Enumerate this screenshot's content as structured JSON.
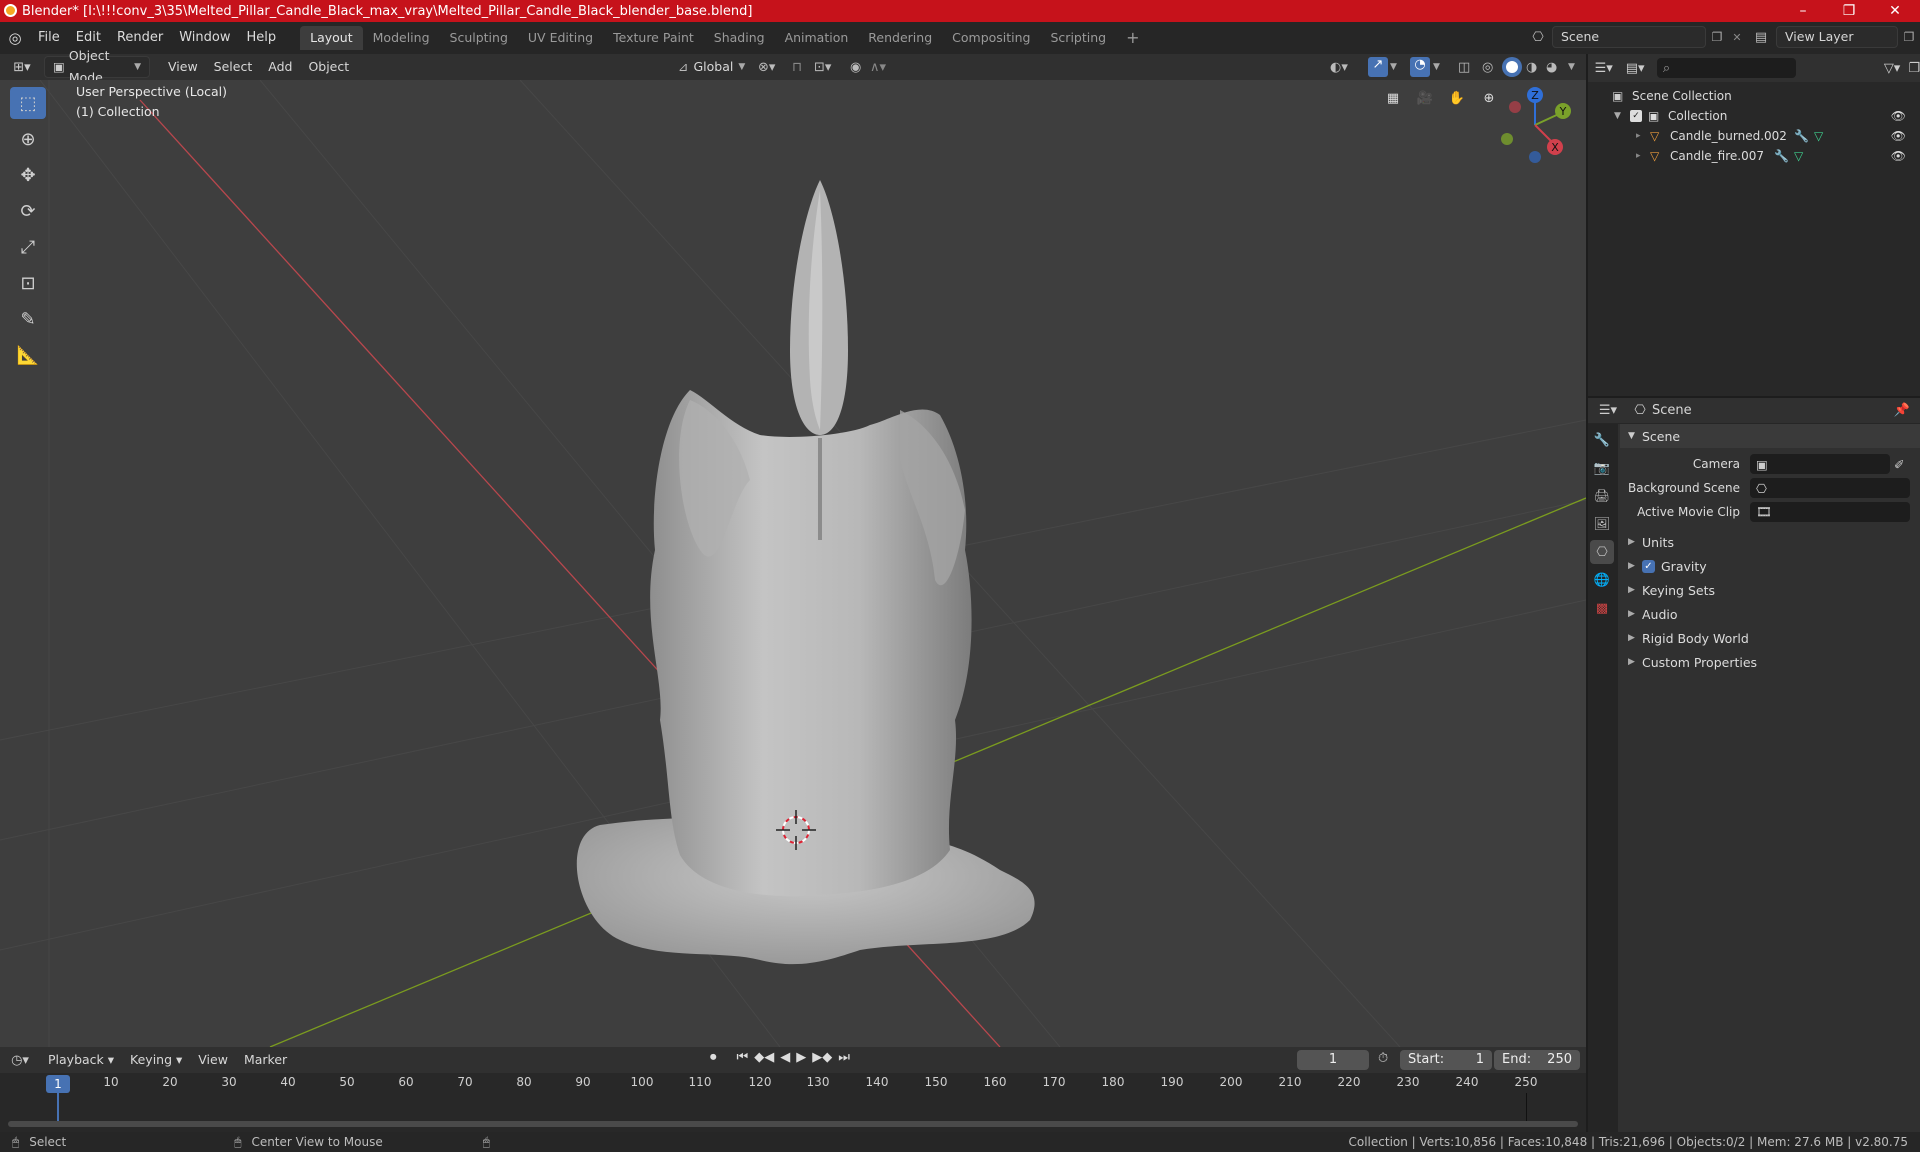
{
  "window": {
    "title": "Blender* [I:\\!!!conv_3\\35\\Melted_Pillar_Candle_Black_max_vray\\Melted_Pillar_Candle_Black_blender_base.blend]",
    "minimize": "–",
    "maximize": "❐",
    "close": "✕"
  },
  "menu": {
    "items": [
      "File",
      "Edit",
      "Render",
      "Window",
      "Help"
    ]
  },
  "workspaces": {
    "tabs": [
      "Layout",
      "Modeling",
      "Sculpting",
      "UV Editing",
      "Texture Paint",
      "Shading",
      "Animation",
      "Rendering",
      "Compositing",
      "Scripting"
    ],
    "active": "Layout",
    "add": "+"
  },
  "scene_selector": {
    "value": "Scene"
  },
  "view_layer_selector": {
    "value": "View Layer"
  },
  "viewport_header": {
    "mode": "Object Mode",
    "menus": [
      "View",
      "Select",
      "Add",
      "Object"
    ],
    "orientation": "Global"
  },
  "viewport": {
    "perspective_label": "User Perspective (Local)",
    "collection_label": "(1) Collection",
    "background_color": "#3e3e3e",
    "grid_color": "#474747",
    "x_axis_color": "#b8474d",
    "y_axis_color": "#7b9c1f",
    "gizmo": {
      "z": "Z",
      "y": "Y",
      "x": "X"
    }
  },
  "tools": [
    "select-box",
    "cursor",
    "move",
    "rotate",
    "scale",
    "transform",
    "annotate",
    "measure"
  ],
  "outliner": {
    "search_placeholder": "",
    "root": "Scene Collection",
    "collection": "Collection",
    "objects": [
      "Candle_burned.002",
      "Candle_fire.007"
    ]
  },
  "properties": {
    "context": "Scene",
    "panel": "Scene",
    "fields": [
      {
        "label": "Camera",
        "value": ""
      },
      {
        "label": "Background Scene",
        "value": ""
      },
      {
        "label": "Active Movie Clip",
        "value": ""
      }
    ],
    "sections": [
      "Units",
      "Gravity",
      "Keying Sets",
      "Audio",
      "Rigid Body World",
      "Custom Properties"
    ],
    "gravity_enabled": true
  },
  "timeline": {
    "menus": [
      "Playback",
      "Keying",
      "View",
      "Marker"
    ],
    "current_frame": "1",
    "start_label": "Start:",
    "start": "1",
    "end_label": "End:",
    "end": "250",
    "ticks": [
      "1",
      "10",
      "20",
      "30",
      "40",
      "50",
      "60",
      "70",
      "80",
      "90",
      "100",
      "110",
      "120",
      "130",
      "140",
      "150",
      "160",
      "170",
      "180",
      "190",
      "200",
      "210",
      "220",
      "230",
      "240",
      "250"
    ]
  },
  "status": {
    "left": "Select",
    "middle": "Center View to Mouse",
    "right": "Collection | Verts:10,856 | Faces:10,848 | Tris:21,696 | Objects:0/2 | Mem: 27.6 MB | v2.80.75"
  },
  "colors": {
    "title_bar": "#c6121b",
    "accent": "#4772b3"
  }
}
